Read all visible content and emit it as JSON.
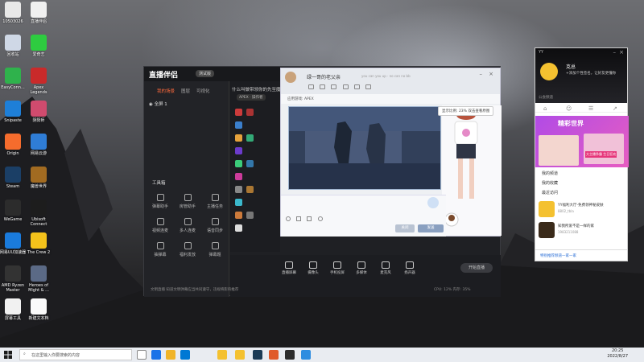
{
  "desktop_icons": [
    {
      "label": "10503026",
      "icon": "folder-icon",
      "color": "#e8e8e8"
    },
    {
      "label": "直播伴侣",
      "icon": "doc-icon",
      "color": "#f0f0f0"
    },
    {
      "label": "回收站",
      "icon": "recycle-bin-icon",
      "color": "#cfd8e6"
    },
    {
      "label": "爱奇艺",
      "icon": "iqiyi-icon",
      "color": "#2ecc40"
    },
    {
      "label": "EasyConn...",
      "icon": "easyconnect-icon",
      "color": "#2fb24c"
    },
    {
      "label": "Apex Legends",
      "icon": "apex-icon",
      "color": "#c92a2a"
    },
    {
      "label": "Snipaste",
      "icon": "snipaste-icon",
      "color": "#1e7fd8"
    },
    {
      "label": "阴阳师",
      "icon": "game-icon",
      "color": "#d04b6e"
    },
    {
      "label": "Origin",
      "icon": "origin-icon",
      "color": "#f56c2d"
    },
    {
      "label": "网易云游",
      "icon": "cloud-game-icon",
      "color": "#2f7dd6"
    },
    {
      "label": "Steam",
      "icon": "steam-icon",
      "color": "#1b3f66"
    },
    {
      "label": "魔兽世界",
      "icon": "wow-icon",
      "color": "#a26b21"
    },
    {
      "label": "WeGame",
      "icon": "wegame-icon",
      "color": "#2c2c2c"
    },
    {
      "label": "Ubisoft Connect",
      "icon": "ubisoft-icon",
      "color": "#1d1d1d"
    },
    {
      "label": "网易UU加速器",
      "icon": "uu-icon",
      "color": "#1a7bdc"
    },
    {
      "label": "The Crew 2",
      "icon": "crew-icon",
      "color": "#f4c21b"
    },
    {
      "label": "AMD Ryzen Master",
      "icon": "amd-icon",
      "color": "#333333"
    },
    {
      "label": "Heroes of Might & ...",
      "icon": "heroes-icon",
      "color": "#5b6a86"
    },
    {
      "label": "屏幕工具",
      "icon": "tool-icon",
      "color": "#f1f1f1"
    },
    {
      "label": "新建文本档",
      "icon": "text-file-icon",
      "color": "#fafafa"
    }
  ],
  "main_window": {
    "brand": "直播伴侣",
    "beta": "测试版",
    "left_tabs": [
      "我的场景",
      "图层",
      "可视化"
    ],
    "scene": "全屏 1",
    "tools_title": "工具箱",
    "tools": [
      "弹幕助手",
      "房管助手",
      "主播任务",
      "视频连麦",
      "多人连麦",
      "语音同步",
      "抽弹幕",
      "福利发放",
      "弹幕题"
    ],
    "mid_title": "什么叫做带领你的先至魔旅",
    "mid_tag": "APEX · 操作者",
    "bottom_items": [
      "直播屏幕",
      "摄像头",
      "手机投屏",
      "多媒体",
      "麦克风",
      "扬声器"
    ],
    "start_button": "开始直播",
    "notice": "文明直播 知道文明弹幕应当共同遵守，违规将影响推荐",
    "status": "CPU: 12%  内存: 35%"
  },
  "chat_window": {
    "name": "绿一哥的老父亲",
    "sub": "you can you up · no can no bb",
    "bar_title": "应用游戏: APEX",
    "send_label": "发送",
    "close_label": "关闭"
  },
  "tooltip": "显示比例: 23%  双击查看原图",
  "yy": {
    "logo": "YY",
    "nick": "克总",
    "sign": "+添加个性签名，让好友更懂你",
    "search": "公会频道",
    "banner_title": "精彩世界",
    "banner_tag": "大主播争霸 生日狂欢",
    "menu": [
      "我的频道",
      "我的收藏",
      "最近访问"
    ],
    "rows": [
      {
        "title": "YY福利大厅-免费领神秘皮肤",
        "sub": "8802_tbla"
      },
      {
        "title": "知我所爱不是一样的家",
        "sub": "1983211088"
      }
    ],
    "footer": "特别推荐频道一家一家"
  },
  "taskbar": {
    "search": "在这里输入你要搜索的内容",
    "time": "20:25",
    "date": "2022/8/27"
  }
}
